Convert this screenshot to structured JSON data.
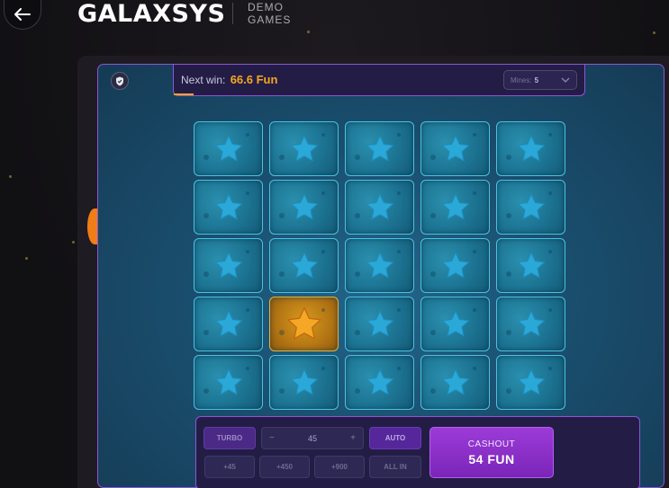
{
  "header": {
    "brand": "GALAXSYS",
    "mode_line1": "DEMO",
    "mode_line2": "GAMES"
  },
  "game": {
    "next_win_label": "Next win:",
    "next_win_value": "66.6 Fun",
    "mines_label": "Mines:",
    "mines_value": "5",
    "grid": {
      "rows": 5,
      "cols": 5,
      "revealed_cell": {
        "row": 4,
        "col": 2
      }
    }
  },
  "controls": {
    "turbo": "TURBO",
    "stepper_minus": "−",
    "stepper_value": "45",
    "stepper_plus": "+",
    "auto": "AUTO",
    "quick_bets": [
      "+45",
      "+450",
      "+900",
      "ALL IN"
    ],
    "cashout_label": "CASHOUT",
    "cashout_amount": "54  FUN"
  },
  "colors": {
    "accent_purple": "#8e54d8",
    "win_orange": "#f6a623",
    "tile_blue": "#1c7392",
    "star_blue": "#2aa8d8",
    "star_gold": "#f4a825"
  }
}
